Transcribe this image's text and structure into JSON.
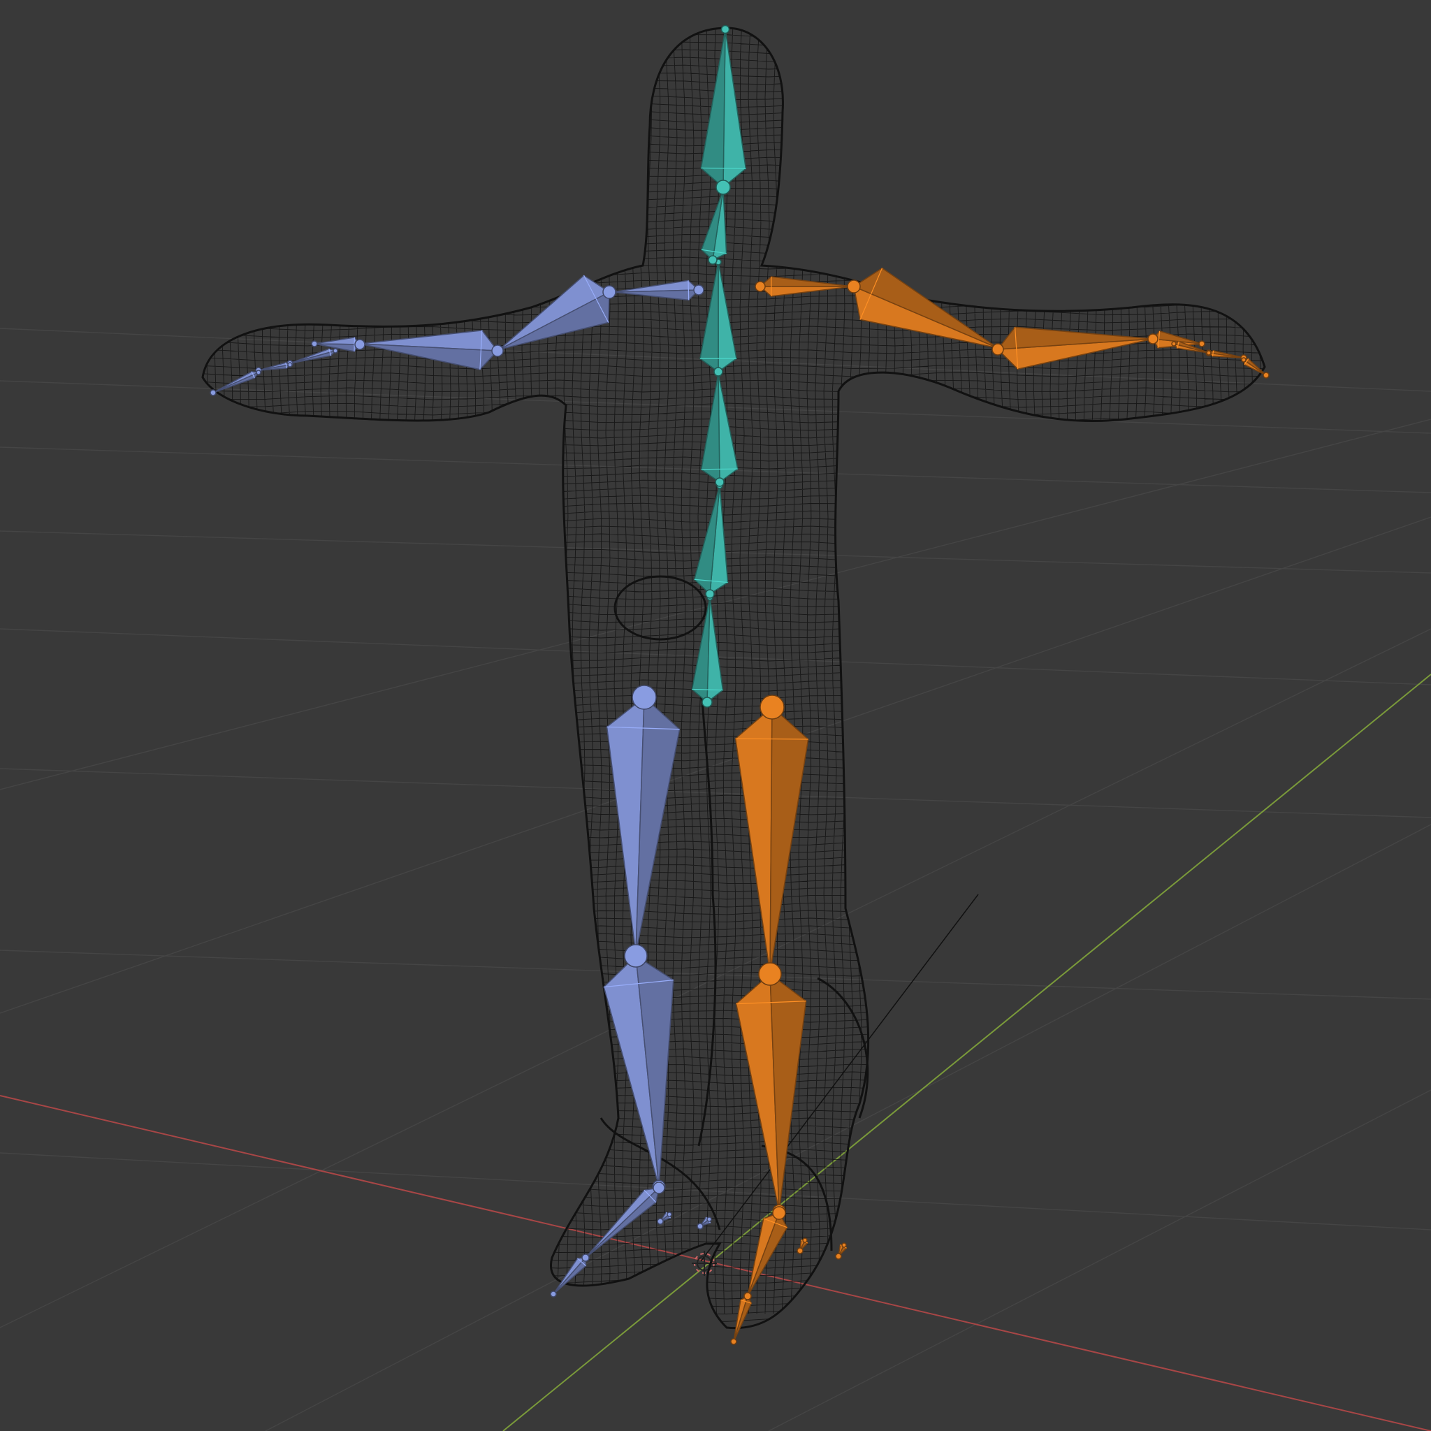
{
  "viewport": {
    "name": "3D Viewport",
    "background": "#393939",
    "grid_color": "#454545",
    "axis_x_color": "#b44a4a",
    "axis_y_color": "#7a9a3a",
    "wire_color": "#111111"
  },
  "armature": {
    "colors": {
      "spine": "#3fb3a8",
      "left": "#7f90d0",
      "right": "#d8781f"
    },
    "bone_groups": [
      "spine",
      "left-arm",
      "right-arm",
      "left-leg",
      "right-leg"
    ]
  },
  "icons": {
    "cursor": "3d-cursor-icon",
    "light": "light-object-icon"
  }
}
